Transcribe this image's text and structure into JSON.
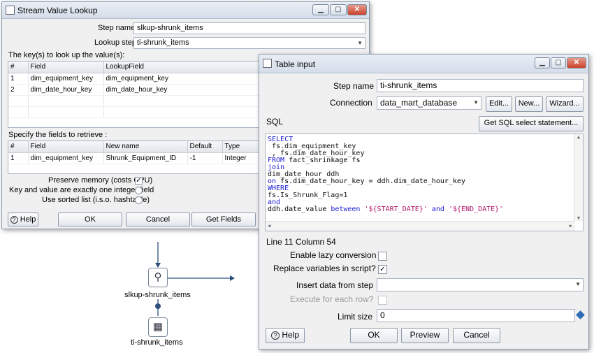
{
  "stream_dialog": {
    "title": "Stream Value Lookup",
    "step_name_label": "Step name",
    "step_name_value": "slkup-shrunk_items",
    "lookup_step_label": "Lookup step",
    "lookup_step_value": "ti-shrunk_items",
    "keys_label": "The key(s) to look up the value(s):",
    "keys_columns": [
      "#",
      "Field",
      "LookupField"
    ],
    "keys_rows": [
      [
        "1",
        "dim_equipment_key",
        "dim_equipment_key"
      ],
      [
        "2",
        "dim_date_hour_key",
        "dim_date_hour_key"
      ]
    ],
    "retrieve_label": "Specify the fields to retrieve :",
    "retrieve_columns": [
      "#",
      "Field",
      "New name",
      "Default",
      "Type"
    ],
    "retrieve_rows": [
      [
        "1",
        "dim_equipment_key",
        "Shrunk_Equipment_ID",
        "-1",
        "Integer"
      ]
    ],
    "preserve_memory_label": "Preserve memory (costs CPU)",
    "preserve_memory_checked": "✓",
    "one_integer_label": "Key and value are exactly one integer field",
    "sorted_list_label": "Use sorted list (i.s.o. hashtable)",
    "help_label": "Help",
    "ok_label": "OK",
    "cancel_label": "Cancel",
    "get_fields_label": "Get Fields"
  },
  "table_dialog": {
    "title": "Table input",
    "step_name_label": "Step name",
    "step_name_value": "ti-shrunk_items",
    "connection_label": "Connection",
    "connection_value": "data_mart_database",
    "edit_label": "Edit...",
    "new_label": "New...",
    "wizard_label": "Wizard...",
    "sql_label": "SQL",
    "get_sql_label": "Get SQL select statement...",
    "sql_lines": {
      "l1": "SELECT",
      "l2": " fs.dim_equipment_key",
      "l3": " , fs.dim_date_hour_key",
      "l4_kw": "FROM",
      "l4": " fact_shrinkage fs",
      "l5": "join",
      "l6": "dim_date_hour ddh",
      "l7_kw": "on",
      "l7": " fs.dim_date_hour_key = ddh.dim_date_hour_key",
      "l8": "WHERE",
      "l9": "fs.Is_Shrunk_Flag=1",
      "l10": "and",
      "l11_a": "ddh.date_value ",
      "l11_kw1": "between",
      "l11_s1": "'${START_DATE}'",
      "l11_kw2": "and",
      "l11_s2": "'${END_DATE}'"
    },
    "position_label": "Line 11 Column 54",
    "lazy_label": "Enable lazy conversion",
    "replace_vars_label": "Replace variables in script?",
    "replace_vars_checked": "✓",
    "insert_data_label": "Insert data from step",
    "execute_label": "Execute for each row?",
    "limit_label": "Limit size",
    "limit_value": "0",
    "help_label": "Help",
    "ok_label": "OK",
    "preview_label": "Preview",
    "cancel_label": "Cancel"
  },
  "canvas": {
    "step1_label": "slkup-shrunk_items",
    "step2_label": "ti-shrunk_items"
  }
}
